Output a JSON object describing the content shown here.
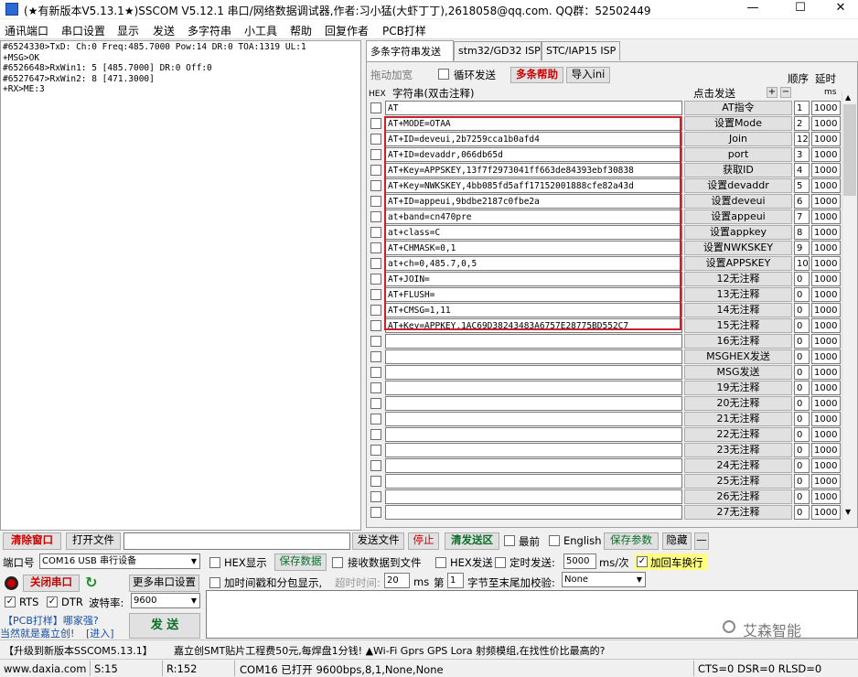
{
  "window": {
    "title": "(★有新版本V5.13.1★)SSCOM V5.12.1 串口/网络数据调试器,作者:习小猛(大虾丁丁),2618058@qq.com. QQ群：52502449",
    "min": "—",
    "max": "☐",
    "close": "✕"
  },
  "menu": [
    "通讯端口",
    "串口设置",
    "显示",
    "发送",
    "多字符串",
    "小工具",
    "帮助",
    "回复作者",
    "PCB打样"
  ],
  "log_lines": [
    "#6524330>TxD: Ch:0 Freq:485.7000 Pow:14 DR:0 TOA:1319 UL:1",
    "+MSG>OK",
    "#6526648>RxWin1: 5 [485.7000] DR:0 Off:0",
    "#6527647>RxWin2: 8 [471.3000]",
    "+RX>ME:3"
  ],
  "tabs": [
    "多条字符串发送",
    "stm32/GD32 ISP",
    "STC/IAP15 ISP"
  ],
  "panel": {
    "drag_label": "拖动加宽",
    "loop_label": "循环发送",
    "help_btn": "多条帮助",
    "import_btn": "导入ini",
    "order_label": "顺序",
    "delay_label": "延时",
    "hex_label": "HEX",
    "string_label": "字符串(双击注释)",
    "click_send": "点击发送",
    "plus": "+",
    "minus": "−",
    "ms_label": "ms"
  },
  "rows": [
    {
      "text": "AT",
      "button": "AT指令",
      "order": "1",
      "delay": "1000"
    },
    {
      "text": "AT+MODE=OTAA",
      "button": "设置Mode",
      "order": "2",
      "delay": "1000"
    },
    {
      "text": "AT+ID=deveui,2b7259cca1b0afd4",
      "button": "Join",
      "order": "12",
      "delay": "1000"
    },
    {
      "text": "AT+ID=devaddr,066db65d",
      "button": "port",
      "order": "3",
      "delay": "1000"
    },
    {
      "text": "AT+Key=APPSKEY,13f7f2973041ff663de84393ebf30838",
      "button": "获取ID",
      "order": "4",
      "delay": "1000"
    },
    {
      "text": "AT+Key=NWKSKEY,4bb085fd5aff17152001888cfe82a43d",
      "button": "设置devaddr",
      "order": "5",
      "delay": "1000"
    },
    {
      "text": "AT+ID=appeui,9bdbe2187c0fbe2a",
      "button": "设置deveui",
      "order": "6",
      "delay": "1000"
    },
    {
      "text": "at+band=cn470pre",
      "button": "设置appeui",
      "order": "7",
      "delay": "1000"
    },
    {
      "text": "at+class=C",
      "button": "设置appkey",
      "order": "8",
      "delay": "1000"
    },
    {
      "text": "AT+CHMASK=0,1",
      "button": "设置NWKSKEY",
      "order": "9",
      "delay": "1000"
    },
    {
      "text": "at+ch=0,485.7,0,5",
      "button": "设置APPSKEY",
      "order": "10",
      "delay": "1000"
    },
    {
      "text": "AT+JOIN=",
      "button": "12无注释",
      "order": "0",
      "delay": "1000"
    },
    {
      "text": "AT+FLUSH=",
      "button": "13无注释",
      "order": "0",
      "delay": "1000"
    },
    {
      "text": "AT+CMSG=1,11",
      "button": "14无注释",
      "order": "0",
      "delay": "1000"
    },
    {
      "text": "AT+Key=APPKEY,1AC69D38243483A6757E28775BD552C7",
      "button": "15无注释",
      "order": "0",
      "delay": "1000"
    },
    {
      "text": "",
      "button": "16无注释",
      "order": "0",
      "delay": "1000"
    },
    {
      "text": "",
      "button": "MSGHEX发送",
      "order": "0",
      "delay": "1000"
    },
    {
      "text": "",
      "button": "MSG发送",
      "order": "0",
      "delay": "1000"
    },
    {
      "text": "",
      "button": "19无注释",
      "order": "0",
      "delay": "1000"
    },
    {
      "text": "",
      "button": "20无注释",
      "order": "0",
      "delay": "1000"
    },
    {
      "text": "",
      "button": "21无注释",
      "order": "0",
      "delay": "1000"
    },
    {
      "text": "",
      "button": "22无注释",
      "order": "0",
      "delay": "1000"
    },
    {
      "text": "",
      "button": "23无注释",
      "order": "0",
      "delay": "1000"
    },
    {
      "text": "",
      "button": "24无注释",
      "order": "0",
      "delay": "1000"
    },
    {
      "text": "",
      "button": "25无注释",
      "order": "0",
      "delay": "1000"
    },
    {
      "text": "",
      "button": "26无注释",
      "order": "0",
      "delay": "1000"
    },
    {
      "text": "",
      "button": "27无注释",
      "order": "0",
      "delay": "1000"
    }
  ],
  "toolbar": {
    "clear": "清除窗口",
    "open_file": "打开文件",
    "send_file": "发送文件",
    "stop": "停止",
    "clear_send": "清发送区",
    "topmost": "最前",
    "english": "English",
    "save_params": "保存参数",
    "hide": "隐藏",
    "dash": "—"
  },
  "controls": {
    "port_label": "端口号",
    "port_value": "COM16 USB 串行设备",
    "hex_display": "HEX显示",
    "save_data": "保存数据",
    "recv_to_file": "接收数据到文件",
    "hex_send": "HEX发送",
    "timed_send": "定时发送:",
    "interval": "5000",
    "interval_unit": "ms/次",
    "add_crlf": "加回车换行",
    "close_port": "关闭串口",
    "more_settings": "更多串口设置",
    "timestamp": "加时间戳和分包显示,",
    "timeout_label": "超时时间:",
    "timeout_value": "20",
    "timeout_unit": "ms",
    "nth_label": "第",
    "nth_value": "1",
    "byte_to_end": "字节至末尾加校验:",
    "checksum": "None",
    "rts": "RTS",
    "dtr": "DTR",
    "baud_label": "波特率:",
    "baud": "9600",
    "pcb_line1": "【PCB打样】哪家强?",
    "pcb_line2": "当然就是嘉立创!",
    "pcb_link": "[进入]",
    "send": "发 送",
    "watermark": "艾森智能"
  },
  "ad": {
    "upgrade": "【升级到新版本SSCOM5.13.1】",
    "text": "嘉立创SMT贴片工程费50元,每焊盘1分钱! ▲Wi-Fi Gprs GPS Lora 射频模组,在找性价比最高的?"
  },
  "status": {
    "site": "www.daxia.com",
    "s": "S:15",
    "r": "R:152",
    "port": "COM16 已打开  9600bps,8,1,None,None",
    "lines": "CTS=0 DSR=0 RLSD=0"
  }
}
